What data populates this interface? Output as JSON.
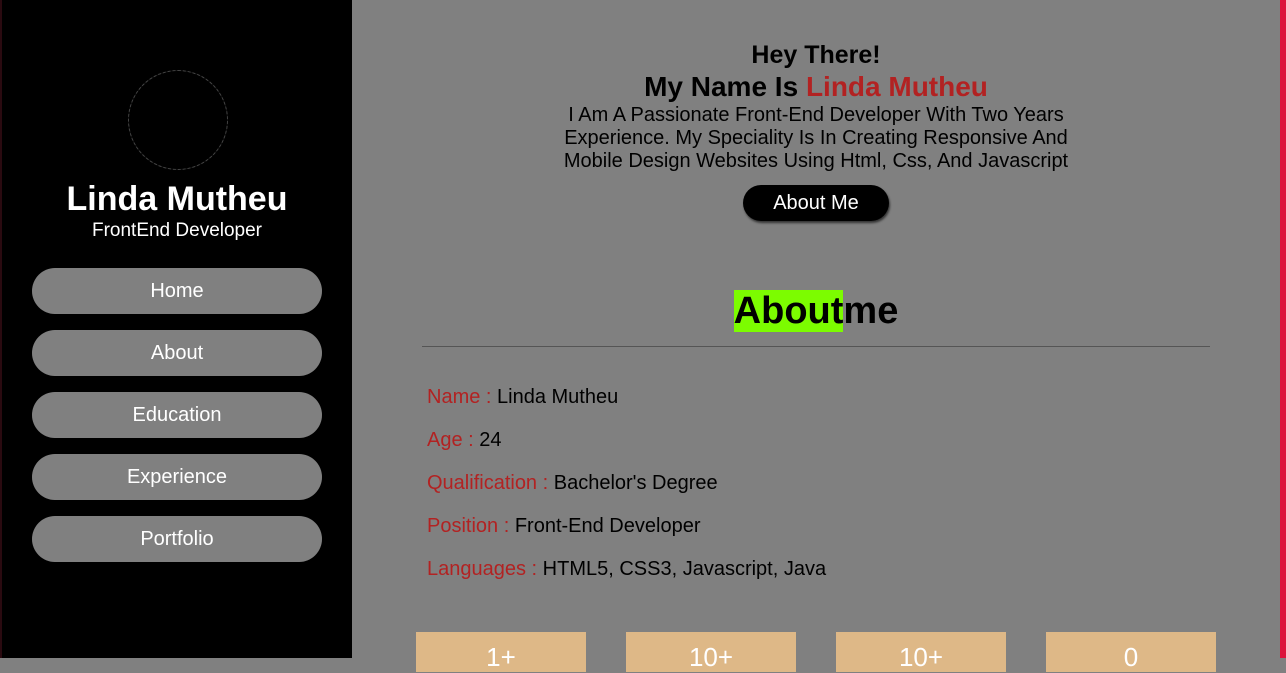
{
  "sidebar": {
    "name": "Linda Mutheu",
    "role": "FrontEnd Developer",
    "nav": [
      {
        "label": "Home"
      },
      {
        "label": "About"
      },
      {
        "label": "Education"
      },
      {
        "label": "Experience"
      },
      {
        "label": "Portfolio"
      }
    ]
  },
  "hero": {
    "greeting": "Hey There!",
    "name_prefix": "My Name Is ",
    "name": "Linda Mutheu",
    "intro": "I Am A Passionate Front-End Developer With Two Years Experience. My Speciality Is In Creating Responsive And Mobile Design Websites Using Html, Css, And Javascript",
    "button": "About Me"
  },
  "about": {
    "title_highlight": "About",
    "title_rest": "me",
    "info": [
      {
        "key": "Name :",
        "value": "Linda Mutheu"
      },
      {
        "key": "Age :",
        "value": "24"
      },
      {
        "key": "Qualification :",
        "value": "Bachelor's Degree"
      },
      {
        "key": "Position :",
        "value": "Front-End Developer"
      },
      {
        "key": "Languages :",
        "value": "HTML5, CSS3, Javascript, Java"
      }
    ]
  },
  "stats": [
    {
      "value": "1+"
    },
    {
      "value": "10+"
    },
    {
      "value": "10+"
    },
    {
      "value": "0"
    }
  ],
  "colors": {
    "accent": "#b22222",
    "highlight": "#7cfc00",
    "stat_bg": "#deb887",
    "edge": "#dc143c"
  }
}
